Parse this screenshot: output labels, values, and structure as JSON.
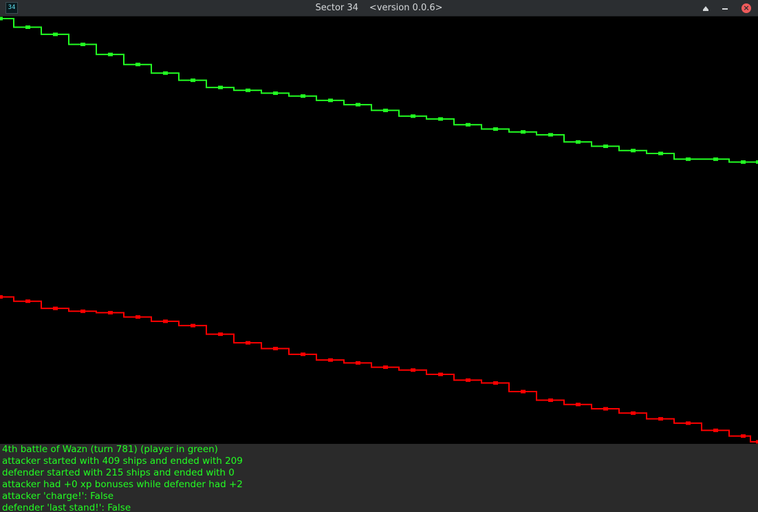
{
  "window": {
    "icon_text": "34",
    "title": "Sector 34",
    "version": "<version 0.0.6>",
    "controls": {
      "keep_above_glyph": "▲",
      "minimize_glyph": "–",
      "close_glyph": "×"
    }
  },
  "colors": {
    "background": "#000000",
    "player_line": "#22ff22",
    "enemy_line": "#ff0000",
    "info_text": "#22ff22",
    "info_background": "#2a2a2a"
  },
  "chart_data": {
    "type": "line",
    "x": [
      0,
      40,
      80,
      120,
      160,
      200,
      240,
      280,
      320,
      360,
      400,
      440,
      480,
      520,
      560,
      600,
      640,
      680,
      720,
      760,
      800,
      840,
      880,
      920,
      960,
      1000,
      1040,
      1080,
      1102
    ],
    "series": [
      {
        "role": "attacker",
        "color": "#22ff22",
        "values": [
          409,
          403,
          398,
          391,
          384,
          377,
          371,
          366,
          361,
          359,
          357,
          355,
          352,
          349,
          345,
          341,
          339,
          335,
          332,
          330,
          328,
          323,
          320,
          317,
          315,
          311,
          311,
          309,
          309
        ]
      },
      {
        "role": "defender",
        "color": "#ff0000",
        "values": [
          215,
          212,
          207,
          205,
          204,
          201,
          198,
          195,
          189,
          183,
          179,
          175,
          171,
          169,
          166,
          164,
          161,
          157,
          155,
          149,
          143,
          140,
          137,
          134,
          130,
          127,
          122,
          118,
          114
        ]
      }
    ],
    "ylim": [
      114,
      409
    ]
  },
  "info": {
    "lines": [
      "4th battle of Wazn (turn 781) (player in green)",
      "attacker started with 409 ships and ended with 209",
      "defender started with 215 ships and ended with 0",
      "attacker had +0 xp bonuses while defender had +2",
      "attacker 'charge!': False",
      "defender 'last stand!': False"
    ]
  }
}
